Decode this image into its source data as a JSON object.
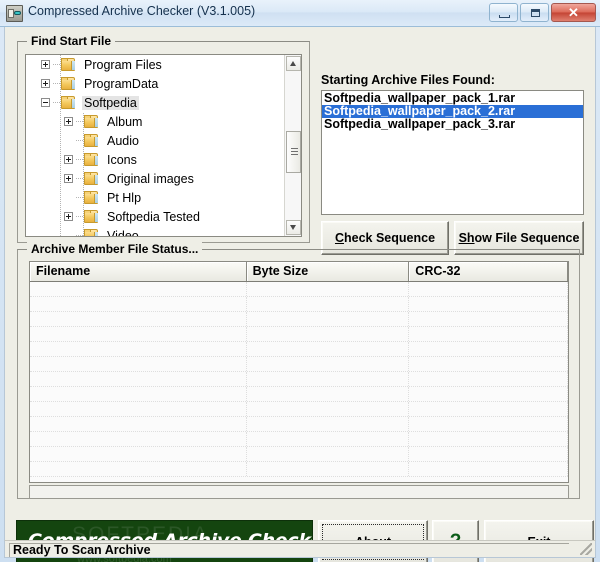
{
  "window": {
    "title": "Compressed Archive Checker (V3.1.005)",
    "icon": "archive-app-icon",
    "controls": {
      "minimize": "minimize-button",
      "maximize": "maximize-button",
      "close_glyph": "✕"
    }
  },
  "find_group": {
    "label": "Find Start File",
    "tree": {
      "items": [
        {
          "label": "Program Files",
          "depth": 1,
          "expander": "plus",
          "selected": false
        },
        {
          "label": "ProgramData",
          "depth": 1,
          "expander": "plus",
          "selected": false
        },
        {
          "label": "Softpedia",
          "depth": 1,
          "expander": "minus",
          "selected": true
        },
        {
          "label": "Album",
          "depth": 2,
          "expander": "plus",
          "selected": false
        },
        {
          "label": "Audio",
          "depth": 2,
          "expander": "none",
          "selected": false
        },
        {
          "label": "Icons",
          "depth": 2,
          "expander": "plus",
          "selected": false
        },
        {
          "label": "Original images",
          "depth": 2,
          "expander": "plus",
          "selected": false
        },
        {
          "label": "Pt Hlp",
          "depth": 2,
          "expander": "none",
          "selected": false
        },
        {
          "label": "Softpedia Tested",
          "depth": 2,
          "expander": "plus",
          "selected": false
        },
        {
          "label": "Video",
          "depth": 2,
          "expander": "none",
          "selected": false
        }
      ]
    }
  },
  "archives": {
    "label": "Starting Archive Files Found:",
    "items": [
      {
        "name": "Softpedia_wallpaper_pack_1.rar",
        "selected": false
      },
      {
        "name": "Softpedia_wallpaper_pack_2.rar",
        "selected": true
      },
      {
        "name": "Softpedia_wallpaper_pack_3.rar",
        "selected": false
      }
    ],
    "selection_color": "#2a6fd6"
  },
  "actions": {
    "check_sequence": {
      "accel": "C",
      "rest": "heck Sequence"
    },
    "show_file_sequence": {
      "accel": "Sh",
      "rest": "ow File Sequence"
    }
  },
  "status_group": {
    "label": "Archive Member File Status...",
    "columns": [
      "Filename",
      "Byte Size",
      "CRC-32"
    ],
    "rows": [],
    "empty_row_count": 13
  },
  "banner": {
    "text": "Compressed Archive Checker",
    "watermark": "SOFTPEDIA",
    "watermark_url": "www.softpedia.com",
    "color": "#14450f"
  },
  "bottom_bar": {
    "about": {
      "accel": "A",
      "rest": "bout"
    },
    "help": "?",
    "exit": {
      "pre": "E",
      "accel": "x",
      "rest": "it"
    }
  },
  "statusbar": {
    "text": "Ready To Scan Archive"
  }
}
